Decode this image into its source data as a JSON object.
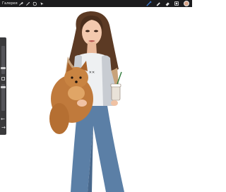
{
  "toolbar": {
    "gallery_label": "Галерея",
    "left_tools": [
      "wrench-icon",
      "magic-wand-icon",
      "selection-icon",
      "transform-arrow-icon"
    ],
    "right_tools": [
      "brush-icon",
      "smudge-icon",
      "eraser-icon",
      "layers-icon"
    ],
    "active_tool": "brush-icon",
    "current_color": "#d8a58a"
  },
  "sidebar": {
    "controls": [
      "brush-size-slider",
      "modify-button",
      "opacity-slider",
      "undo-icon",
      "redo-icon"
    ]
  },
  "colors": {
    "toolbar_bg": "#1c1c1e",
    "sidebar_bg": "#3a3a3c",
    "accent": "#3c7dd9"
  }
}
